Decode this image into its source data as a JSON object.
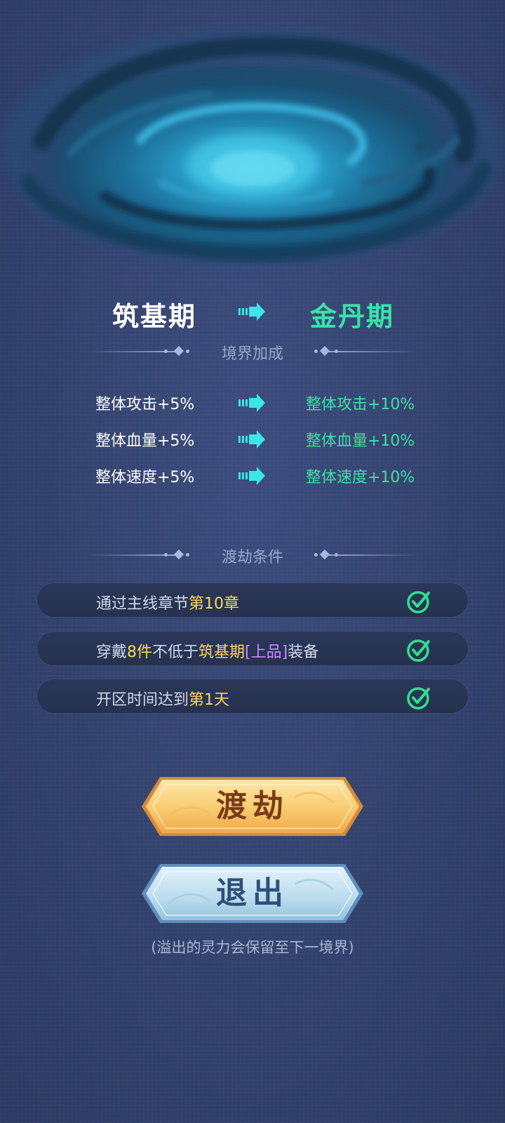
{
  "realm": {
    "from": "筑基期",
    "to": "金丹期"
  },
  "bonus_section": {
    "title": "境界加成",
    "rows": [
      {
        "from": "整体攻击+5%",
        "to": "整体攻击+10%"
      },
      {
        "from": "整体血量+5%",
        "to": "整体血量+10%"
      },
      {
        "from": "整体速度+5%",
        "to": "整体速度+10%"
      }
    ]
  },
  "condition_section": {
    "title": "渡劫条件",
    "conditions": [
      {
        "parts": [
          "通过主线章节",
          "第10章"
        ],
        "met": true
      },
      {
        "parts": [
          "穿戴",
          "8件",
          "不低于",
          "筑基期",
          "[上品]",
          "装备"
        ],
        "met": true
      },
      {
        "parts": [
          "开区时间达到",
          "第1天"
        ],
        "met": true
      }
    ]
  },
  "buttons": {
    "cross": "渡劫",
    "exit": "退出"
  },
  "footnote": "(溢出的灵力会保留至下一境界)",
  "colors": {
    "next_realm": "#38e3a8",
    "highlight": "#ffd75a",
    "quality": "#c88bff",
    "check": "#2fe08c"
  }
}
